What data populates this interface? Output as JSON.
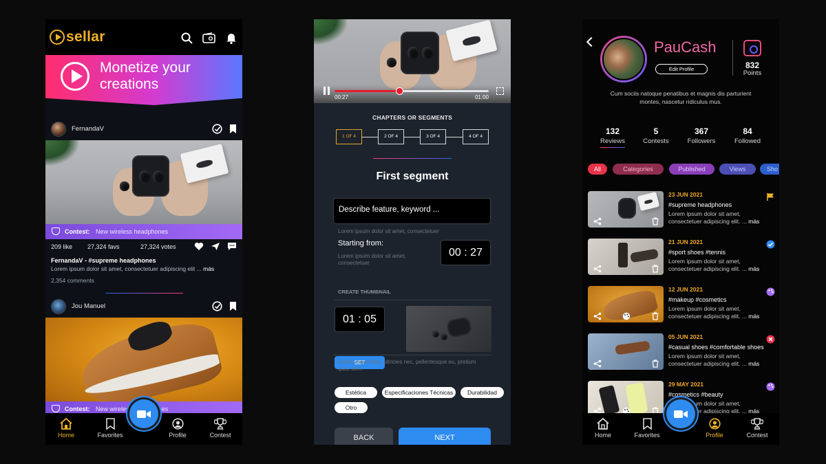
{
  "feed": {
    "app_name": "sellar",
    "banner_text_line1": "Monetize your",
    "banner_text_line2": "creations",
    "posts": [
      {
        "user": "FernandaV",
        "contest_label": "Contest:",
        "contest_value": "New wireless headphones",
        "likes": "209 like",
        "favs": "27,324 favs",
        "votes": "27,324 votes",
        "caption": "FernandaV - #supreme headphones",
        "desc": "Lorem ipsum dolor sit amet, consectetuer adipiscing elit ...",
        "more": "más",
        "comments": "2,354 comments"
      },
      {
        "user": "Jou Manuel",
        "contest_label": "Contest:",
        "contest_value": "New wireless headphones"
      }
    ],
    "nav": [
      {
        "label": "Home",
        "icon": "home-icon"
      },
      {
        "label": "Favorites",
        "icon": "bookmark-icon"
      },
      {
        "label": "Profile",
        "icon": "user-icon"
      },
      {
        "label": "Contest",
        "icon": "trophy-icon"
      }
    ]
  },
  "editor": {
    "time_current": "00:27",
    "time_total": "01:00",
    "progress": 0.42,
    "chapters_title": "CHAPTERS OR SEGMENTS",
    "chapters": [
      "1 OF 4",
      "2 OF 4",
      "3 OF 4",
      "4 OF 4"
    ],
    "segment_title": "First segment",
    "describe_placeholder": "Describe feature, keyword ...",
    "describe_hint": "Lorem ipsum dolor sit amet, consectetuer",
    "starting_label": "Starting from:",
    "starting_hint_1": "Lorem ipsum dolor sit amet,",
    "starting_hint_2": "consectetuer",
    "start_time": "00 : 27",
    "thumbnail_label": "CREATE THUMBNAIL",
    "thumb_time": "01 : 05",
    "set_label": "SET",
    "thumb_hint_1": "Donec quam felis, ultricies nec, pellentesque eu, pretium",
    "thumb_hint_2": "quis, sem.",
    "tags": [
      "Estética",
      "Especificaciones Técnicas",
      "Durabilidad",
      "Otro"
    ],
    "back_label": "BACK",
    "next_label": "NEXT"
  },
  "profile": {
    "name": "PauCash",
    "edit_label": "Edit Profile",
    "points": "832",
    "points_label": "Points",
    "bio_line1": "Cum sociis natoque penatibus et magnis dis parturient",
    "bio_line2": "montes, nascetur ridiculus mus.",
    "stats": [
      {
        "n": "132",
        "l": "Reviews"
      },
      {
        "n": "5",
        "l": "Contests"
      },
      {
        "n": "367",
        "l": "Followers"
      },
      {
        "n": "84",
        "l": "Followed"
      }
    ],
    "filters": [
      "All",
      "Categories",
      "Published",
      "Views",
      "Sho"
    ],
    "items": [
      {
        "date": "23 JUN 2021",
        "title": "#supreme headphones",
        "d1": "Lorem ipsum dolor sit amet,",
        "d2": "consectetuer adipiscing elit. ...",
        "more": "más",
        "badge": "flag-icon"
      },
      {
        "date": "21 JUN 2021",
        "title": "#sport shoes #tennis",
        "d1": "Lorem ipsum dolor sit amet,",
        "d2": "consectetuer adipiscing elit. ...",
        "more": "más",
        "badge": "check-badge-icon"
      },
      {
        "date": "12 JUN 2021",
        "title": "#makeup #cosmetics",
        "d1": "Lorem ipsum dolor sit amet,",
        "d2": "consectetuer adipiscing elit. ...",
        "more": "más",
        "badge": "palette-icon"
      },
      {
        "date": "05 JUN 2021",
        "title": "#casual shoes #comfortable shoes",
        "d1": "Lorem ipsum dolor sit amet,",
        "d2": "consectetuer adipiscing elit. ...",
        "more": "más",
        "badge": "close-badge-icon"
      },
      {
        "date": "29 MAY 2021",
        "title": "#cosmetics #beauty",
        "d1": "Lorem ipsum dolor sit amet,",
        "d2": "consectetuer adipiscing elit. ...",
        "more": "más",
        "badge": "palette-icon"
      }
    ],
    "nav": [
      {
        "label": "Home",
        "icon": "home-icon"
      },
      {
        "label": "Favorites",
        "icon": "bookmark-icon"
      },
      {
        "label": "Profile",
        "icon": "user-icon"
      },
      {
        "label": "Contest",
        "icon": "trophy-icon"
      }
    ]
  },
  "colors": {
    "accent": "#f0b429",
    "primary": "#2e8bf0",
    "brand_pink": "#f06aa5",
    "contest_purple": "#8e5cf0"
  }
}
